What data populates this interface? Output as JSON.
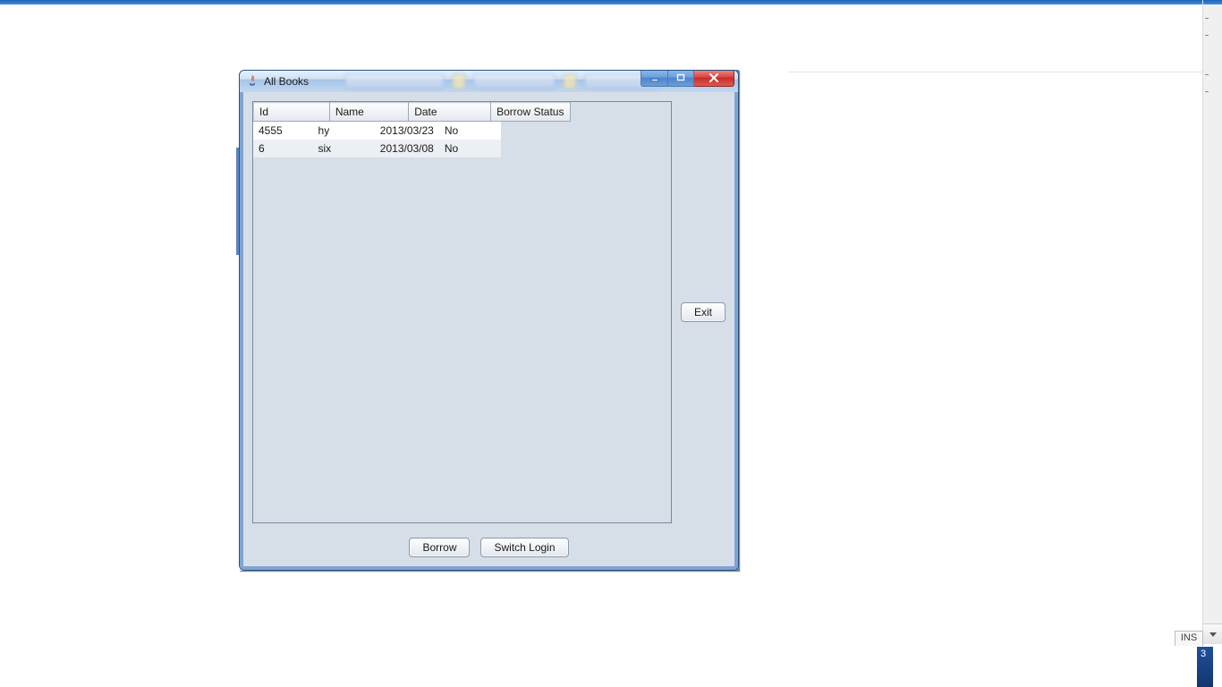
{
  "top": {},
  "status": {
    "ins": "INS",
    "taskbar_digit": "3"
  },
  "window": {
    "title": "All Books",
    "buttons": {
      "exit": "Exit",
      "borrow": "Borrow",
      "switch_login": "Switch Login"
    },
    "table": {
      "headers": {
        "id": "Id",
        "name": "Name",
        "date": "Date",
        "status": "Borrow Status"
      },
      "rows": [
        {
          "id": "4555",
          "name": "hy",
          "date": "2013/03/23",
          "status": "No"
        },
        {
          "id": "6",
          "name": "six",
          "date": "2013/03/08",
          "status": "No"
        }
      ]
    }
  }
}
